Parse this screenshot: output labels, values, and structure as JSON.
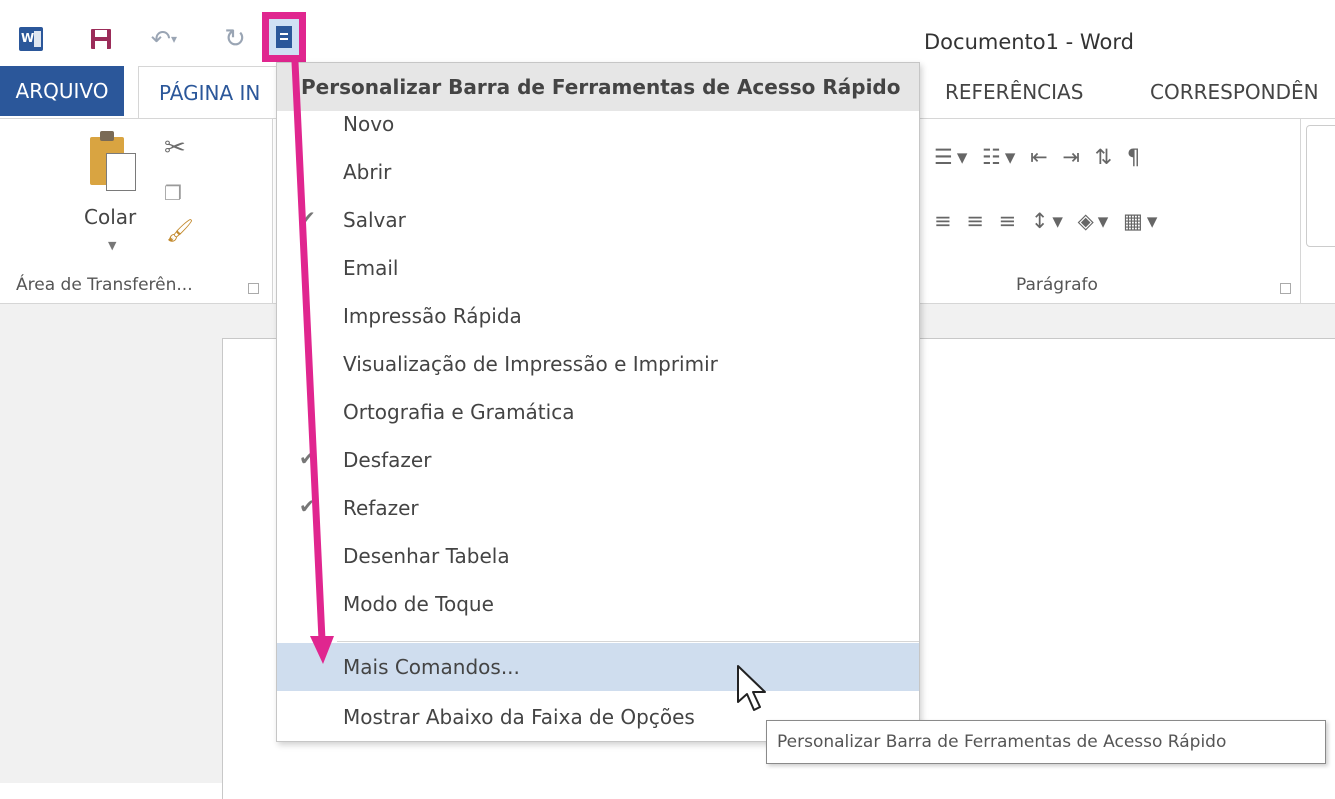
{
  "window": {
    "title": "Documento1 - Word"
  },
  "quick_access": {
    "icons": [
      "word-logo",
      "save-icon",
      "undo-icon",
      "redo-icon",
      "customize-qat-icon"
    ],
    "word_logo_letter": "W"
  },
  "tabs": {
    "arquivo": "ARQUIVO",
    "pagina_inicial": "PÁGINA IN",
    "referencias": "REFERÊNCIAS",
    "correspondencias": "CORRESPONDÊN"
  },
  "ribbon": {
    "clipboard": {
      "paste_label": "Colar",
      "group_label": "Área de Transferên..."
    },
    "paragraph": {
      "group_label": "Parágrafo"
    }
  },
  "menu": {
    "header": "Personalizar Barra de Ferramentas de Acesso Rápido",
    "items": [
      {
        "label": "Novo",
        "checked": false
      },
      {
        "label": "Abrir",
        "checked": false
      },
      {
        "label": "Salvar",
        "checked": true
      },
      {
        "label": "Email",
        "checked": false
      },
      {
        "label": "Impressão Rápida",
        "checked": false
      },
      {
        "label": "Visualização de Impressão e Imprimir",
        "checked": false
      },
      {
        "label": "Ortografia e Gramática",
        "checked": false
      },
      {
        "label": "Desfazer",
        "checked": true
      },
      {
        "label": "Refazer",
        "checked": true
      },
      {
        "label": "Desenhar Tabela",
        "checked": false
      },
      {
        "label": "Modo de Toque",
        "checked": false
      }
    ],
    "more_commands": "Mais Comandos...",
    "show_below_ribbon": "Mostrar Abaixo da Faixa de Opções"
  },
  "tooltip": "Personalizar Barra de Ferramentas de Acesso Rápido",
  "colors": {
    "word_blue": "#2b579a",
    "highlight_magenta": "#e0268f",
    "menu_hover": "#cfddee"
  }
}
